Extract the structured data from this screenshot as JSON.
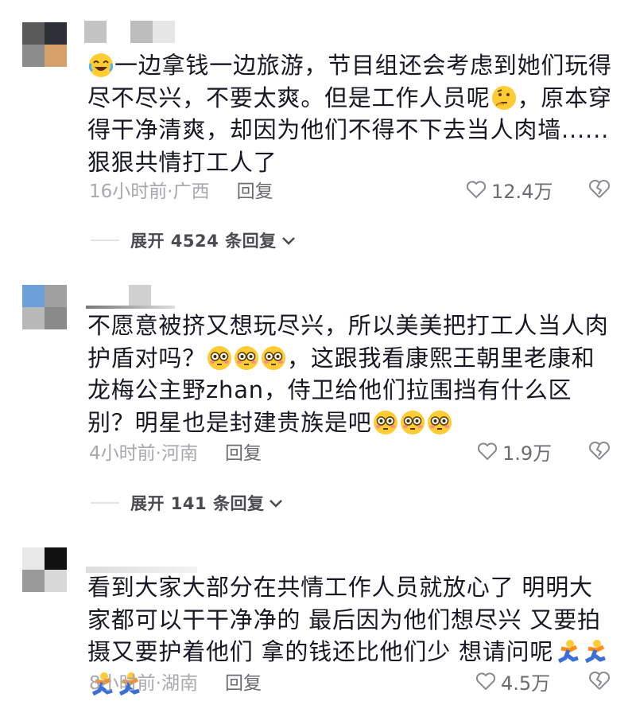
{
  "comments": [
    {
      "text_before_emoji": "一边拿钱一边旅游，节目组还会考虑到她们玩得尽不尽兴，不要太爽。但是工作人员呢",
      "text_after_emoji": "，原本穿得干净清爽，却因为他们不得不下去当人肉墙......狠狠共情打工人了",
      "time_location": "16小时前·广西",
      "reply_label": "回复",
      "likes": "12.4万",
      "expand_label": "展开 4524 条回复"
    },
    {
      "text_a": "不愿意被挤又想玩尽兴，所以美美把打工人当人肉护盾对吗？",
      "text_b": "，这跟我看康熙王朝里老康和龙梅公主野zhan，侍卫给他们拉围挡有什么区别？明星也是封建贵族是吧",
      "time_location": "4小时前·河南",
      "reply_label": "回复",
      "likes": "1.9万",
      "expand_label": "展开 141 条回复"
    },
    {
      "text": "看到大家大部分在共情工作人员就放心了 明明大家都可以干干净净的 最后因为他们想尽兴 又要拍摄又要护着他们 拿的钱还比他们少 想请问呢",
      "time_location": "8小时前·湖南",
      "reply_label": "回复",
      "likes": "4.5万"
    }
  ],
  "icons": {
    "like": "heart-outline-icon",
    "dislike": "broken-heart-icon",
    "expand": "chevron-down-icon",
    "emoji_laugh": "laughing-crying-emoji-icon",
    "emoji_think": "thinking-face-emoji-icon",
    "emoji_flushed": "flushed-face-emoji-icon",
    "emoji_running": "running-person-emoji-icon"
  },
  "colors": {
    "text": "#161823",
    "meta": "#a8a8ad",
    "action": "#6b6b70"
  }
}
